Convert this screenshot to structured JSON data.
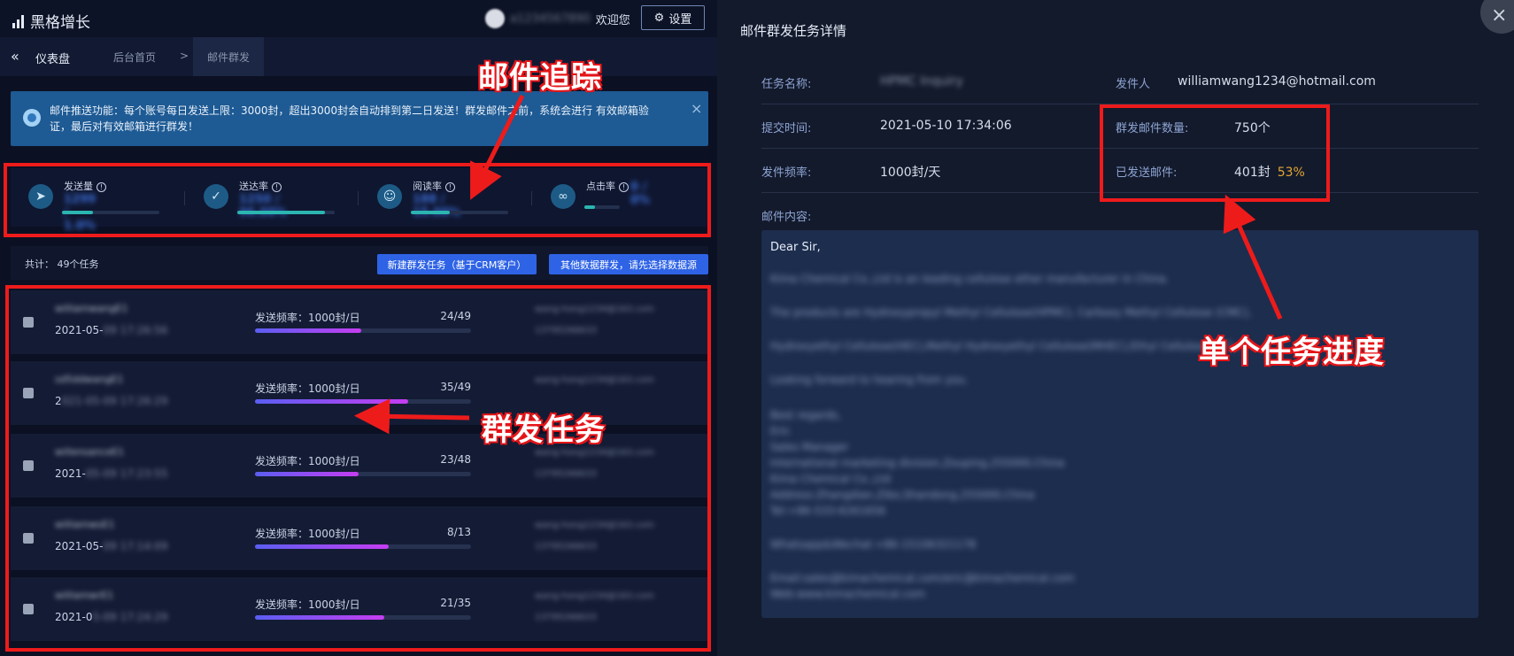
{
  "app": {
    "logo_text": "黑格增长"
  },
  "header": {
    "user_name": "a1234567890",
    "welcome": "欢迎您",
    "settings_label": "设置"
  },
  "nav": {
    "dashboard_label": "仪表盘",
    "tabs": [
      {
        "label": "后台首页"
      },
      {
        "label": "邮件群发"
      }
    ],
    "separator": ">"
  },
  "notice": {
    "text": "邮件推送功能：每个账号每日发送上限：3000封，超出3000封会自动排到第二日发送！群发邮件之前，系统会进行 有效邮箱验证，最后对有效邮箱进行群发！",
    "close": "×"
  },
  "stats": [
    {
      "label": "发送量",
      "value": "1299 / 1.0%",
      "icon": "send-icon",
      "fill": 0.32
    },
    {
      "label": "送达率",
      "value": "1250 / 96.00%",
      "icon": "check-icon",
      "fill": 0.9
    },
    {
      "label": "阅读率",
      "value": "188 / 15.00%",
      "icon": "reader-icon",
      "fill": 0.4
    },
    {
      "label": "点击率",
      "value": "0 / 0%",
      "icon": "link-icon",
      "fill": 0.3
    }
  ],
  "toolbar": {
    "count_text": "共计： 49个任务",
    "new_task_label": "新建群发任务（基于CRM客户）",
    "other_data_label": "其他数据群发，请先选择数据源"
  },
  "tasks": [
    {
      "name": "williamwangE1",
      "date": "2021-05-",
      "date_tail": "09 17:26:56",
      "freq": "发送频率：1000封/日",
      "ratio": "24/49",
      "progress": 0.49,
      "email": "wang-hong1234@163.com",
      "phone": "13795266633"
    },
    {
      "name": "sd5ddwangE1",
      "date": "2",
      "date_tail": "021-05-09 17:26:29",
      "freq": "发送频率：1000封/日",
      "ratio": "35/49",
      "progress": 0.71,
      "email": "wang-hong1234@163.com",
      "phone": ""
    },
    {
      "name": "willensanceE1",
      "date": "2021-",
      "date_tail": "05-09 17:23:55",
      "freq": "发送频率：1000封/日",
      "ratio": "23/48",
      "progress": 0.48,
      "email": "wang-hong1234@163.com",
      "phone": "13795266633"
    },
    {
      "name": "williamwsE1",
      "date": "2021-05-",
      "date_tail": "09 17:14:09",
      "freq": "发送频率：1000封/日",
      "ratio": "8/13",
      "progress": 0.62,
      "email": "wang-hong1234@163.com",
      "phone": "13795266633"
    },
    {
      "name": "williamwrE1",
      "date": "2021-0",
      "date_tail": "5-09 17:24:29",
      "freq": "发送频率：1000封/日",
      "ratio": "21/35",
      "progress": 0.6,
      "email": "wang-hong1234@163.com",
      "phone": "13795266633"
    }
  ],
  "detail": {
    "title": "邮件群发任务详情",
    "task_name_label": "任务名称:",
    "task_name_value": "HPMC Inquiry",
    "sender_label": "发件人",
    "sender_value": "williamwang1234@hotmail.com",
    "submit_time_label": "提交时间:",
    "submit_time_value": "2021-05-10 17:34:06",
    "mail_count_label": "群发邮件数量:",
    "mail_count_value": "750个",
    "freq_label": "发件频率:",
    "freq_value": "1000封/天",
    "sent_label": "已发送邮件:",
    "sent_value": "401封",
    "sent_pct": "53%",
    "content_label": "邮件内容:",
    "mail_first_line": "Dear Sir,",
    "mail_lines": [
      "Kima Chemical Co.,Ltd is an leading cellulose ether manufacturer in China.",
      "The products are Hydroxypropyl Methyl Cellulose(HPMC), Carboxy Methyl Cellulose (CMC),",
      "Hydroxyethyl Cellulose(HEC),Methyl Hydroxyethyl Cellulose(MHEC),Ethyl Cellulose (EC)...",
      "Looking forward to hearing from you.",
      "Best regards,",
      "Eric",
      "Sales Manager",
      "International marketing division,Zouping,255000,China",
      "Kima Chemical Co.,Ltd",
      "Address:Zhangdian,Zibo,Shandong,255000,China",
      "Tel:+86-533-6261656",
      "Whatsapp&Wechat:+86-15106321178",
      "Email:sales@kimachemical.com/eric@kimachemical.com",
      "Web:www.kimachemical.com"
    ]
  },
  "annotations": {
    "mail_tracking": "邮件追踪",
    "mass_task": "群发任务",
    "single_progress": "单个任务进度"
  },
  "colors": {
    "annotation_red": "#ee1b1b",
    "primary_blue": "#2e63e6",
    "progress_gradient_start": "#5a5ef2",
    "progress_gradient_end": "#c63df1",
    "pct_orange": "#e2a532"
  }
}
